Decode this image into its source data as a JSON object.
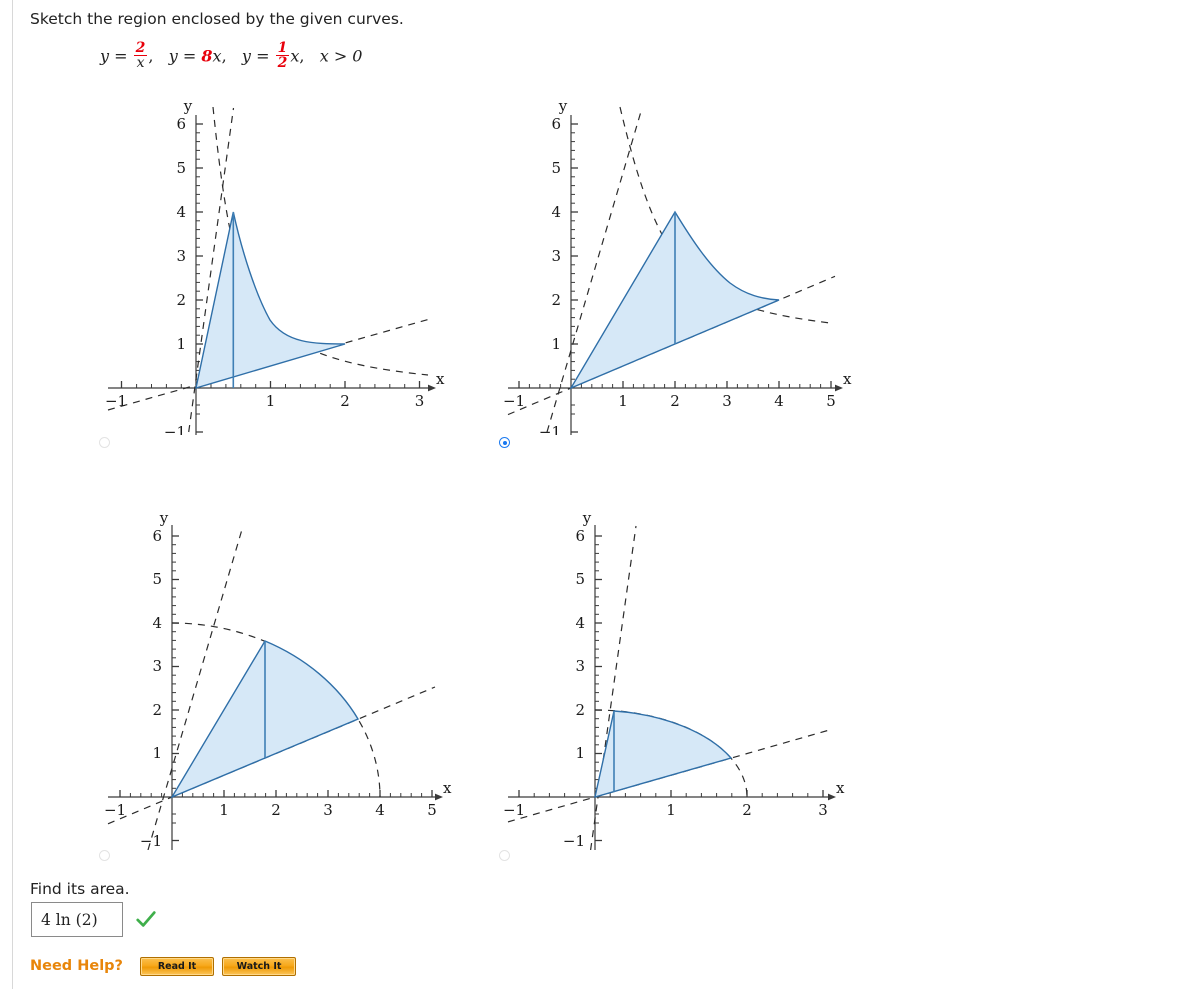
{
  "prompt": "Sketch the region enclosed by the given curves.",
  "equation": {
    "y1_lhs": "y",
    "eq": "=",
    "f1_num": "2",
    "f1_den": "x",
    "comma1": ",",
    "y2_lhs": "y",
    "f2_coeff": "8",
    "f2_var": "x",
    "comma2": ",",
    "y3_lhs": "y",
    "f3_num": "1",
    "f3_den": "2",
    "f3_var": "x",
    "comma3": ",",
    "domain": "x > 0"
  },
  "options": [
    {
      "id": "option-a",
      "selected": false,
      "position": "top-left"
    },
    {
      "id": "option-b",
      "selected": true,
      "position": "top-right"
    },
    {
      "id": "option-c",
      "selected": false,
      "position": "bottom-left"
    },
    {
      "id": "option-d",
      "selected": false,
      "position": "bottom-right"
    }
  ],
  "answer_section": {
    "label": "Find its area.",
    "value": "4 ln (2)",
    "placeholder": "",
    "status": "correct",
    "status_icon": "green-check-icon"
  },
  "help": {
    "label": "Need Help?",
    "read_button": "Read It",
    "watch_button": "Watch It"
  },
  "colors": {
    "accent_red": "#e8000b",
    "region_fill": "#d6e8f7",
    "region_stroke": "#2f6fa8",
    "curve_dashed": "#2b2b2b",
    "radio_selected": "#1878f0",
    "help_orange": "#e8860b",
    "check_green": "#3faf4b"
  },
  "chart_data": [
    {
      "type": "line",
      "id": "chart-a",
      "title": "",
      "xlabel": "x",
      "ylabel": "y",
      "xlim": [
        -1.35,
        3.3
      ],
      "ylim": [
        -1.25,
        6.4
      ],
      "xticks": [
        -1,
        1,
        2,
        3
      ],
      "yticks": [
        -1,
        1,
        2,
        3,
        4,
        5,
        6
      ],
      "grid": false,
      "legend": "none",
      "series": [
        {
          "name": "y = 8x",
          "style": "dashed",
          "type": "line",
          "slope": 8
        },
        {
          "name": "y = 2/x",
          "style": "dashed",
          "type": "hyperbola",
          "k": 2
        },
        {
          "name": "y = x/2",
          "style": "dashed",
          "type": "line",
          "slope": 0.5
        }
      ],
      "region_vertices": [
        [
          0,
          0
        ],
        [
          0.5,
          4
        ],
        [
          2,
          1
        ]
      ],
      "region_note": "bounded above by y=8x then y=2/x, below by y=x/2",
      "inner_segment": {
        "x": 0.5,
        "y0": 0,
        "y1": 4
      }
    },
    {
      "type": "line",
      "id": "chart-b",
      "title": "",
      "xlabel": "x",
      "ylabel": "y",
      "xlim": [
        -1.4,
        5.5
      ],
      "ylim": [
        -1.25,
        6.4
      ],
      "xticks": [
        -1,
        1,
        2,
        3,
        4,
        5
      ],
      "yticks": [
        -1,
        1,
        2,
        3,
        4,
        5,
        6
      ],
      "grid": false,
      "legend": "none",
      "series": [
        {
          "name": "y = 2x",
          "style": "dashed",
          "type": "line",
          "slope": 2
        },
        {
          "name": "y = 8/x",
          "style": "dashed",
          "type": "hyperbola",
          "k": 8
        },
        {
          "name": "y = x/2",
          "style": "dashed",
          "type": "line",
          "slope": 0.5
        }
      ],
      "region_vertices": [
        [
          0,
          0
        ],
        [
          2,
          4
        ],
        [
          4,
          2
        ]
      ],
      "region_note": "bounded above by y=2x then y=8/x, below by y=x/2",
      "inner_segment": {
        "x": 2,
        "y0": 1,
        "y1": 4
      }
    },
    {
      "type": "line",
      "id": "chart-c",
      "title": "",
      "xlabel": "x",
      "ylabel": "y",
      "xlim": [
        -1.4,
        5.5
      ],
      "ylim": [
        -1.25,
        6.4
      ],
      "xticks": [
        -1,
        1,
        2,
        3,
        4,
        5
      ],
      "yticks": [
        -1,
        1,
        2,
        3,
        4,
        5,
        6
      ],
      "grid": false,
      "legend": "none",
      "series": [
        {
          "name": "y = 2x",
          "style": "dashed",
          "type": "line",
          "slope": 2
        },
        {
          "name": "circle r = 4",
          "style": "dashed",
          "type": "circle",
          "r": 4
        },
        {
          "name": "y = x/2",
          "style": "dashed",
          "type": "line",
          "slope": 0.5
        }
      ],
      "region_vertices": [
        [
          0,
          0
        ],
        [
          1.789,
          3.578
        ],
        [
          3.578,
          1.789
        ]
      ],
      "region_note": "circular sector of radius 4 between y=2x and y=x/2",
      "inner_segment": {
        "x": 1.789,
        "y0": 0.894,
        "y1": 3.578
      }
    },
    {
      "type": "line",
      "id": "chart-d",
      "title": "",
      "xlabel": "x",
      "ylabel": "y",
      "xlim": [
        -1.35,
        3.3
      ],
      "ylim": [
        -1.25,
        6.4
      ],
      "xticks": [
        -1,
        1,
        2,
        3
      ],
      "yticks": [
        -1,
        1,
        2,
        3,
        4,
        5,
        6
      ],
      "grid": false,
      "legend": "none",
      "series": [
        {
          "name": "y = 8x",
          "style": "dashed",
          "type": "line",
          "slope": 8
        },
        {
          "name": "circle r = 2",
          "style": "dashed",
          "type": "circle",
          "r": 2
        },
        {
          "name": "y = x/2",
          "style": "dashed",
          "type": "line",
          "slope": 0.5
        }
      ],
      "region_vertices": [
        [
          0,
          0
        ],
        [
          0.2481,
          1.9845
        ],
        [
          1.789,
          0.894
        ]
      ],
      "region_note": "circular sector of radius 2 between y=8x and y=x/2",
      "inner_segment": {
        "x": 0.2481,
        "y0": 0.124,
        "y1": 1.9845
      }
    }
  ]
}
